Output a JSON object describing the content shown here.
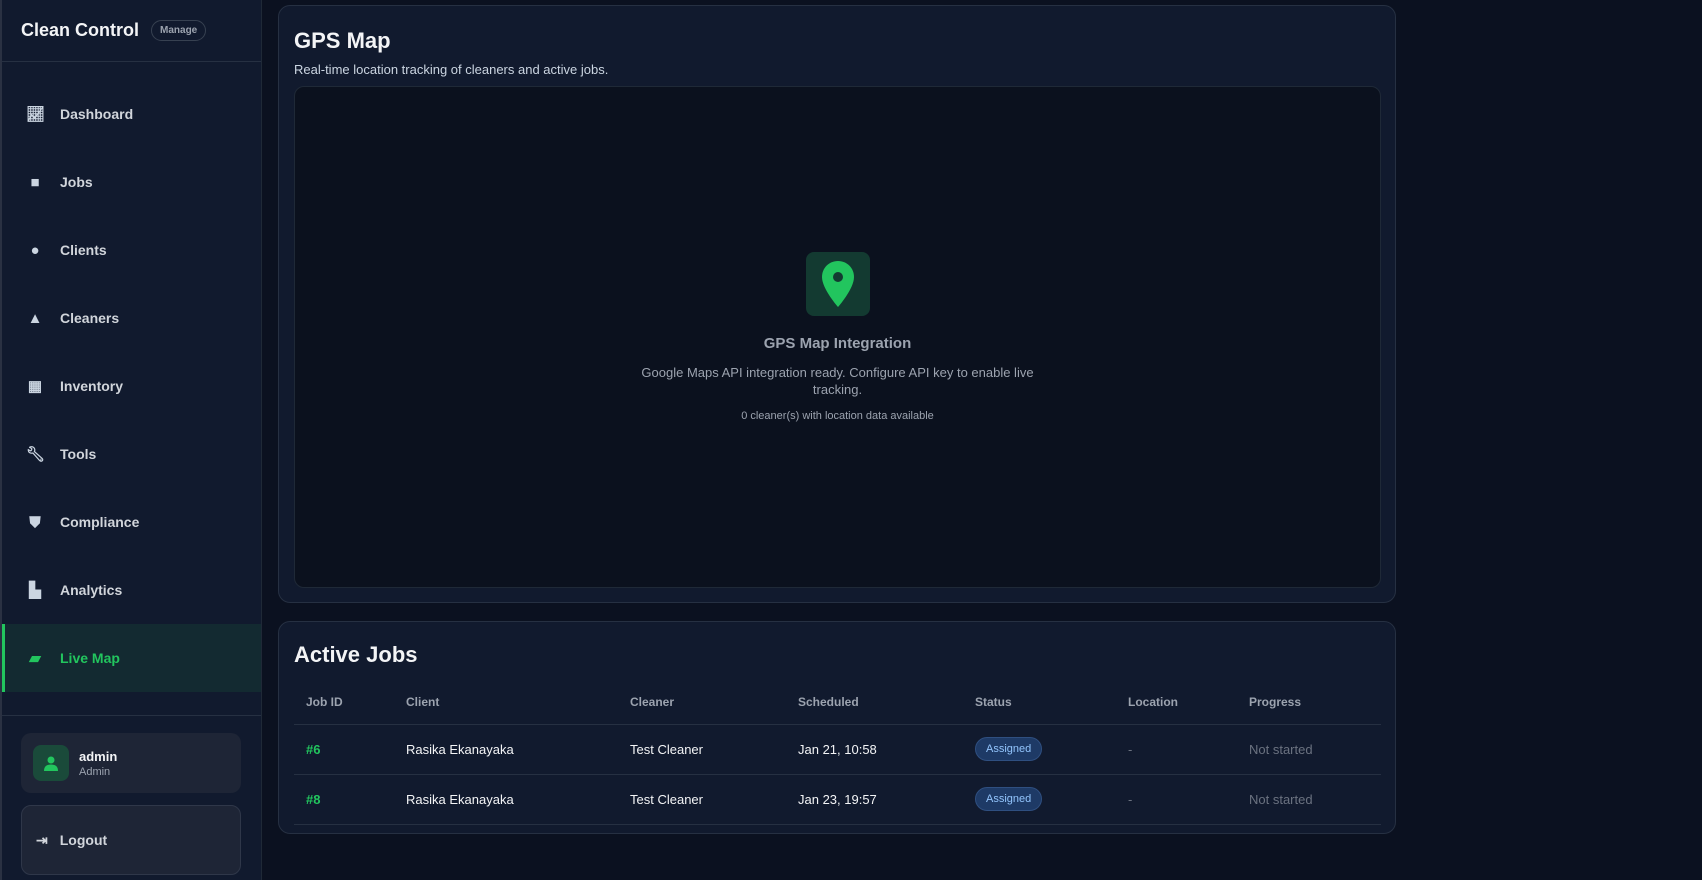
{
  "brand": {
    "title": "Clean Control",
    "badge": "Manage"
  },
  "nav": [
    {
      "label": "Dashboard",
      "icon": "chart-line-icon"
    },
    {
      "label": "Jobs",
      "icon": "briefcase-icon"
    },
    {
      "label": "Clients",
      "icon": "users-icon"
    },
    {
      "label": "Cleaners",
      "icon": "user-tie-icon"
    },
    {
      "label": "Inventory",
      "icon": "boxes-icon"
    },
    {
      "label": "Tools",
      "icon": "wrench-icon"
    },
    {
      "label": "Compliance",
      "icon": "shield-icon"
    },
    {
      "label": "Analytics",
      "icon": "bar-chart-icon"
    },
    {
      "label": "Live Map",
      "icon": "map-icon",
      "active": true
    }
  ],
  "user": {
    "name": "admin",
    "role": "Admin"
  },
  "logout": "Logout",
  "map_card": {
    "title": "GPS Map",
    "subtitle": "Real-time location tracking of cleaners and active jobs.",
    "placeholder_title": "GPS Map Integration",
    "placeholder_text": "Google Maps API integration ready. Configure API key to enable live tracking.",
    "count_text": "0 cleaner(s) with location data available"
  },
  "jobs_card": {
    "title": "Active Jobs",
    "columns": [
      "Job ID",
      "Client",
      "Cleaner",
      "Scheduled",
      "Status",
      "Location",
      "Progress"
    ],
    "rows": [
      {
        "id": "#6",
        "client": "Rasika Ekanayaka",
        "cleaner": "Test Cleaner",
        "scheduled": "Jan 21, 10:58",
        "status": "Assigned",
        "location": "-",
        "progress": "Not started"
      },
      {
        "id": "#8",
        "client": "Rasika Ekanayaka",
        "cleaner": "Test Cleaner",
        "scheduled": "Jan 23, 19:57",
        "status": "Assigned",
        "location": "-",
        "progress": "Not started"
      }
    ]
  },
  "colors": {
    "accent": "#22c55e",
    "bg": "#0b1120",
    "card": "#111a2e"
  }
}
